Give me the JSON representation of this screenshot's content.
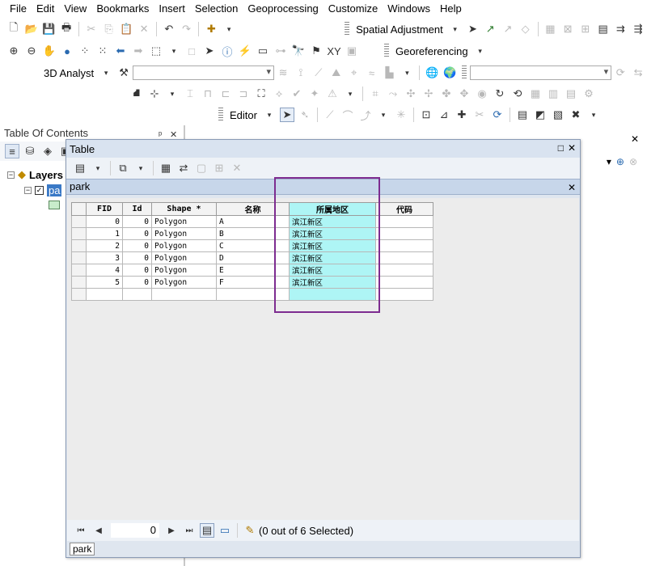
{
  "menu": [
    "File",
    "Edit",
    "View",
    "Bookmarks",
    "Insert",
    "Selection",
    "Geoprocessing",
    "Customize",
    "Windows",
    "Help"
  ],
  "toolbars": {
    "spatial_adjustment": "Spatial Adjustment",
    "georeferencing": "Georeferencing",
    "analyst_3d": "3D Analyst",
    "editor": "Editor"
  },
  "toc": {
    "title": "Table Of Contents",
    "pin": "ᵖ",
    "close": "✕",
    "layers_label": "Layers",
    "layer_abbrev": "pa"
  },
  "table_window": {
    "title": "Table",
    "maximize": "□",
    "close": "✕",
    "layer_tab": "park",
    "layer_close": "✕",
    "columns": [
      "FID",
      "Id",
      "Shape *",
      "名称",
      "所属地区",
      "代码"
    ],
    "rows": [
      [
        "0",
        "0",
        "Polygon",
        "A",
        "滨江新区",
        ""
      ],
      [
        "1",
        "0",
        "Polygon",
        "B",
        "滨江新区",
        ""
      ],
      [
        "2",
        "0",
        "Polygon",
        "C",
        "滨江新区",
        ""
      ],
      [
        "3",
        "0",
        "Polygon",
        "D",
        "滨江新区",
        ""
      ],
      [
        "4",
        "0",
        "Polygon",
        "E",
        "滨江新区",
        ""
      ],
      [
        "5",
        "0",
        "Polygon",
        "F",
        "滨江新区",
        ""
      ]
    ],
    "status": {
      "record": "0",
      "selection_text": "(0 out of 6 Selected)"
    },
    "bottom_tab": "park"
  },
  "right_panel": {
    "close": "✕"
  },
  "colors": {
    "highlight_column": "#aef5f5",
    "annotation_box": "#7d2c90",
    "window_bg": "#dfe6ef",
    "layer_tab_bg": "#c7d6ea"
  }
}
